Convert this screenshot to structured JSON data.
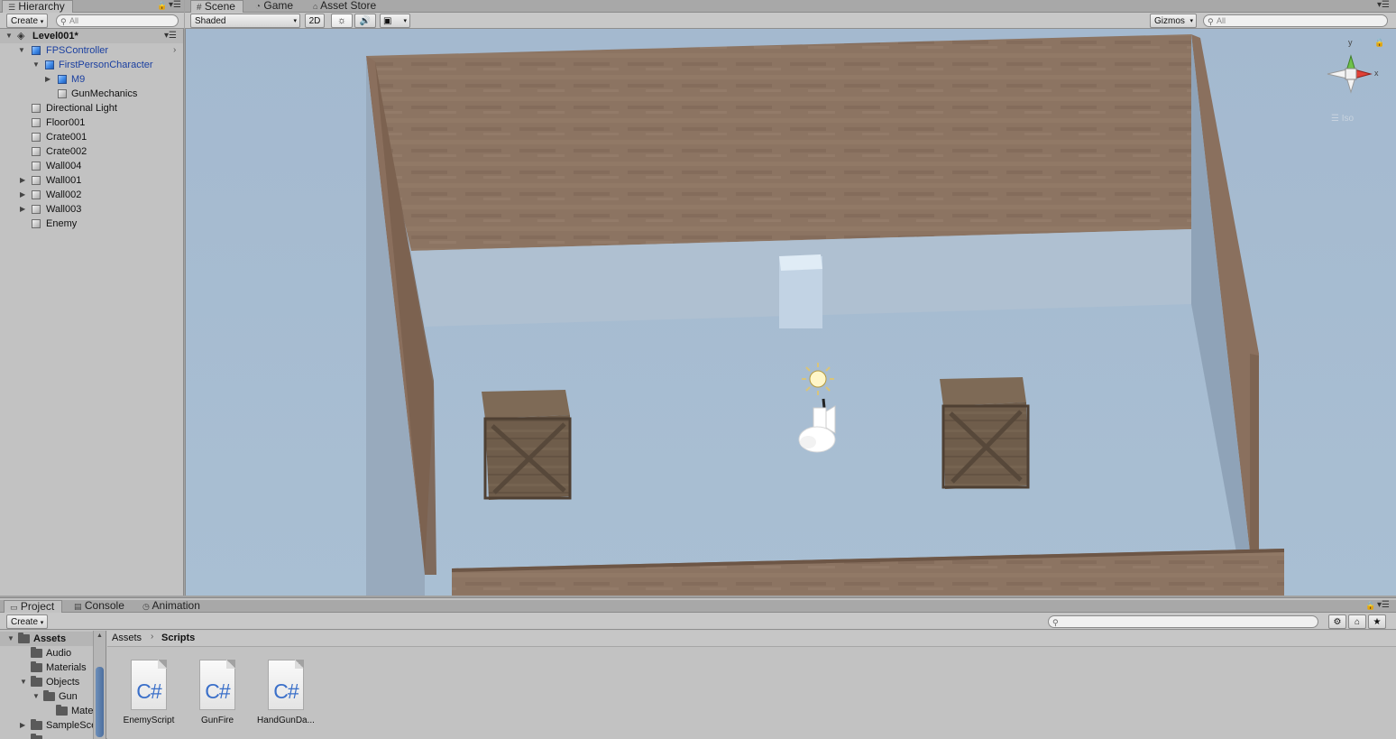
{
  "hierarchy": {
    "tab": "Hierarchy",
    "create": "Create",
    "search_placeholder": "All",
    "scene": "Level001*",
    "items": [
      {
        "label": "FPSController"
      },
      {
        "label": "FirstPersonCharacter"
      },
      {
        "label": "M9"
      },
      {
        "label": "GunMechanics"
      },
      {
        "label": "Directional Light"
      },
      {
        "label": "Floor001"
      },
      {
        "label": "Crate001"
      },
      {
        "label": "Crate002"
      },
      {
        "label": "Wall004"
      },
      {
        "label": "Wall001"
      },
      {
        "label": "Wall002"
      },
      {
        "label": "Wall003"
      },
      {
        "label": "Enemy"
      }
    ]
  },
  "scene_view": {
    "tabs": [
      "Scene",
      "Game",
      "Asset Store"
    ],
    "shading": "Shaded",
    "mode_2d": "2D",
    "gizmos": "Gizmos",
    "search_placeholder": "All",
    "gizmo_y": "y",
    "gizmo_x": "x",
    "projection": "Iso"
  },
  "bottom": {
    "tabs": [
      "Project",
      "Console",
      "Animation"
    ],
    "create": "Create",
    "tree": [
      {
        "label": "Assets"
      },
      {
        "label": "Audio"
      },
      {
        "label": "Materials"
      },
      {
        "label": "Objects"
      },
      {
        "label": "Gun"
      },
      {
        "label": "Mate"
      },
      {
        "label": "SampleSce"
      }
    ],
    "breadcrumb": [
      "Assets",
      "Scripts"
    ],
    "files": [
      {
        "name": "EnemyScript",
        "icon": "C#"
      },
      {
        "name": "GunFire",
        "icon": "C#"
      },
      {
        "name": "HandGunDa...",
        "icon": "C#"
      }
    ]
  },
  "colors": {
    "floor": "#a7bcd0",
    "wall": "#8d7563",
    "crate": "#6e5c4a",
    "selected_text": "#1a3fa0"
  }
}
